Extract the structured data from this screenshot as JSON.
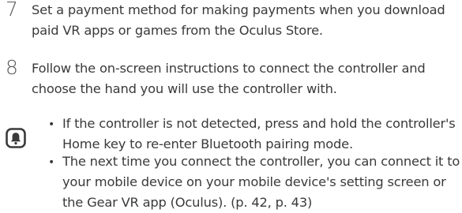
{
  "steps": [
    {
      "number": "7",
      "text": "Set a payment method for making payments when you download paid VR apps or games from the Oculus Store."
    },
    {
      "number": "8",
      "text": "Follow the on-screen instructions to connect the controller and choose the hand you will use the controller with."
    }
  ],
  "note": {
    "icon": "bell-icon",
    "items": [
      "If the controller is not detected, press and hold the controller's Home key to re-enter Bluetooth pairing mode.",
      "The next time you connect the controller, you can connect it to your mobile device on your mobile device's setting screen or the Gear VR app (Oculus). (p. 42, p. 43)"
    ]
  },
  "colors": {
    "text": "#3a3a3a",
    "icon": "#3a3a3a"
  }
}
